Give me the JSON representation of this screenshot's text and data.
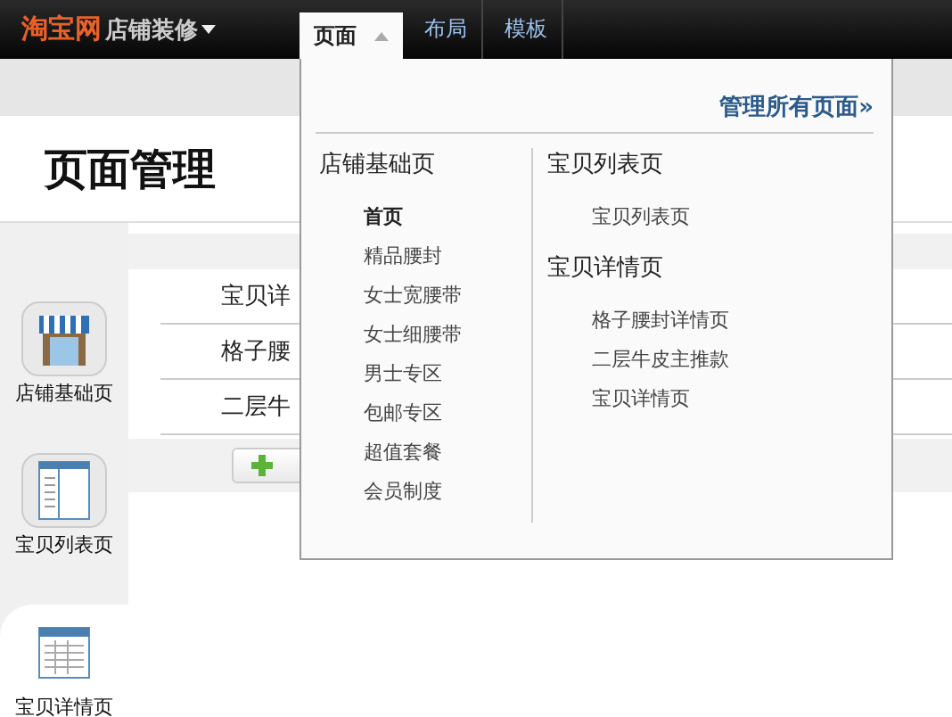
{
  "topbar": {
    "logo": "淘宝网",
    "product": "店铺装修",
    "tabs": [
      {
        "label": "页面",
        "selected": true
      },
      {
        "label": "布局",
        "selected": false
      },
      {
        "label": "模板",
        "selected": false
      }
    ]
  },
  "header": {
    "title": "页面管理"
  },
  "sidebar": {
    "items": [
      {
        "label": "店铺基础页",
        "kind": "store",
        "selected": false
      },
      {
        "label": "宝贝列表页",
        "kind": "list",
        "selected": false
      },
      {
        "label": "宝贝详情页",
        "kind": "detail",
        "selected": true
      }
    ]
  },
  "content": {
    "rows": [
      "宝贝详",
      "格子腰",
      "二层牛"
    ],
    "add_button": {
      "kind": "plus"
    }
  },
  "dropdown": {
    "manage_link": "管理所有页面»",
    "columns": [
      {
        "groups": [
          {
            "title": "店铺基础页",
            "items": [
              {
                "label": "首页",
                "selected": true
              },
              {
                "label": "精品腰封",
                "selected": false
              },
              {
                "label": "女士宽腰带",
                "selected": false
              },
              {
                "label": "女士细腰带",
                "selected": false
              },
              {
                "label": "男士专区",
                "selected": false
              },
              {
                "label": "包邮专区",
                "selected": false
              },
              {
                "label": "超值套餐",
                "selected": false
              },
              {
                "label": "会员制度",
                "selected": false
              }
            ]
          }
        ]
      },
      {
        "groups": [
          {
            "title": "宝贝列表页",
            "items": [
              {
                "label": "宝贝列表页",
                "selected": false
              }
            ]
          },
          {
            "title": "宝贝详情页",
            "items": [
              {
                "label": "格子腰封详情页",
                "selected": false
              },
              {
                "label": "二层牛皮主推款",
                "selected": false
              },
              {
                "label": "宝贝详情页",
                "selected": false
              }
            ]
          }
        ]
      }
    ]
  }
}
